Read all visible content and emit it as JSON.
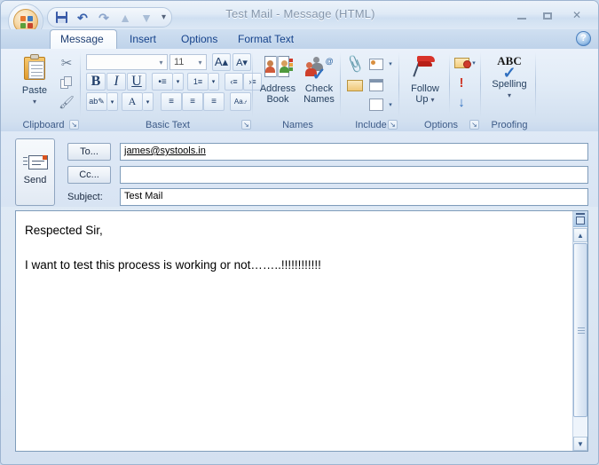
{
  "window": {
    "title": "Test Mail - Message (HTML)",
    "minimize_label": "Minimize",
    "maximize_label": "Maximize",
    "close_label": "Close",
    "accent_color": "#15428b",
    "titlebar_text_color": "#8596ab"
  },
  "office_button": {
    "label": "Office Button"
  },
  "quick_access": {
    "items": [
      {
        "name": "save",
        "label": "Save",
        "glyph": ""
      },
      {
        "name": "undo",
        "label": "Undo",
        "glyph": "↶"
      },
      {
        "name": "redo",
        "label": "Redo",
        "glyph": "↷"
      },
      {
        "name": "previous-item",
        "label": "Previous Item",
        "glyph": "▲"
      },
      {
        "name": "next-item",
        "label": "Next Item",
        "glyph": "▼"
      }
    ],
    "customize_glyph": "▾"
  },
  "tabs": [
    {
      "label": "Message",
      "active": true
    },
    {
      "label": "Insert",
      "active": false
    },
    {
      "label": "Options",
      "active": false
    },
    {
      "label": "Format Text",
      "active": false
    }
  ],
  "help_button": {
    "glyph": "?",
    "label": "Microsoft Office Outlook Help"
  },
  "ribbon": {
    "groups": [
      {
        "name": "clipboard",
        "label": "Clipboard",
        "has_dialog_launcher": true,
        "dialog_glyph": "↘",
        "buttons": [
          {
            "name": "paste",
            "label": "Paste",
            "dropdown_glyph": "▾"
          },
          {
            "name": "cut",
            "label": "Cut"
          },
          {
            "name": "copy",
            "label": "Copy"
          },
          {
            "name": "format-painter",
            "label": "Format Painter"
          }
        ]
      },
      {
        "name": "basic-text",
        "label": "Basic Text",
        "has_dialog_launcher": true,
        "dialog_glyph": "↘",
        "font_name": {
          "value": "",
          "placeholder": "",
          "dropdown_glyph": "▾"
        },
        "font_size": {
          "value": "11",
          "dropdown_glyph": "▾"
        },
        "buttons": [
          {
            "name": "grow-font",
            "label": "A"
          },
          {
            "name": "shrink-font",
            "label": "A"
          },
          {
            "name": "bold",
            "label": "B"
          },
          {
            "name": "italic",
            "label": "I"
          },
          {
            "name": "underline",
            "label": "U"
          },
          {
            "name": "bullets",
            "label": "•≡"
          },
          {
            "name": "numbering",
            "label": "≡"
          },
          {
            "name": "decrease-indent",
            "label": "‹≡"
          },
          {
            "name": "increase-indent",
            "label": "›≡"
          },
          {
            "name": "text-highlight-color",
            "label": "ab"
          },
          {
            "name": "font-color",
            "label": "A"
          },
          {
            "name": "align-left",
            "label": "≡"
          },
          {
            "name": "align-center",
            "label": "≡"
          },
          {
            "name": "align-right",
            "label": "≡"
          },
          {
            "name": "clear-formatting",
            "label": "Aa"
          }
        ]
      },
      {
        "name": "names",
        "label": "Names",
        "has_dialog_launcher": false,
        "buttons": [
          {
            "name": "address-book",
            "label_line1": "Address",
            "label_line2": "Book"
          },
          {
            "name": "check-names",
            "label_line1": "Check",
            "label_line2": "Names"
          }
        ]
      },
      {
        "name": "include",
        "label": "Include",
        "has_dialog_launcher": true,
        "dialog_glyph": "↘",
        "buttons": [
          {
            "name": "attach-file",
            "label": "Attach File"
          },
          {
            "name": "business-card",
            "label": "Business Card",
            "dropdown_glyph": "▾"
          },
          {
            "name": "attach-item",
            "label": "Attach Item"
          },
          {
            "name": "calendar",
            "label": "Calendar"
          },
          {
            "name": "signature",
            "label": "Signature",
            "dropdown_glyph": "▾"
          }
        ]
      },
      {
        "name": "options",
        "label": "Options",
        "has_dialog_launcher": true,
        "dialog_glyph": "↘",
        "buttons": [
          {
            "name": "follow-up",
            "label_line1": "Follow",
            "label_line2": "Up",
            "dropdown_glyph": "▾"
          },
          {
            "name": "permission",
            "label": "Permission",
            "dropdown_glyph": "▾"
          },
          {
            "name": "high-importance",
            "label": "High Importance"
          },
          {
            "name": "low-importance",
            "label": "Low Importance"
          }
        ]
      },
      {
        "name": "proofing",
        "label": "Proofing",
        "has_dialog_launcher": false,
        "buttons": [
          {
            "name": "spelling",
            "label": "Spelling",
            "badge": "ABC",
            "dropdown_glyph": "▾"
          }
        ]
      }
    ]
  },
  "compose": {
    "send_button": {
      "label": "Send"
    },
    "to_button": {
      "label": "To..."
    },
    "cc_button": {
      "label": "Cc..."
    },
    "subject_label": "Subject:",
    "to_value": "james@systools.in",
    "cc_value": "",
    "subject_value": "Test Mail",
    "to_placeholder": "",
    "cc_placeholder": "",
    "subject_placeholder": ""
  },
  "body": {
    "paragraphs": [
      "Respected Sir,",
      "I want to test this process is working or not……..!!!!!!!!!!!!"
    ]
  },
  "scrollbar": {
    "split_label": "Split",
    "up_glyph": "▲",
    "down_glyph": "▼"
  }
}
